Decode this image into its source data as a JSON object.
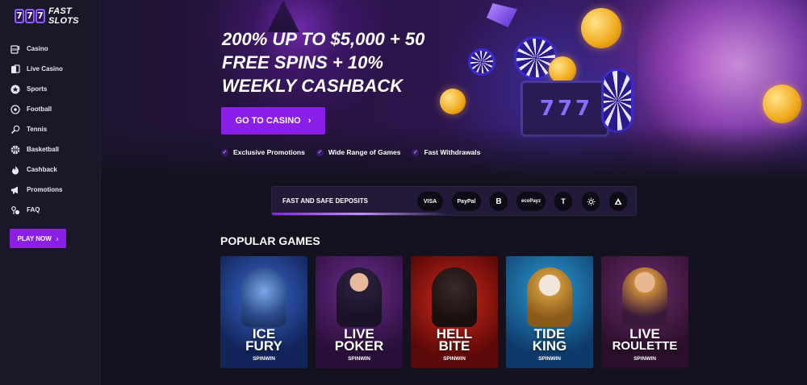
{
  "brand": {
    "logo_digits": "777",
    "name": "FAST SLOTS"
  },
  "sidebar": {
    "items": [
      {
        "label": "Casino",
        "icon": "slot-machine-icon"
      },
      {
        "label": "Live Casino",
        "icon": "cards-icon"
      },
      {
        "label": "Sports",
        "icon": "star-badge-icon"
      },
      {
        "label": "Football",
        "icon": "soccer-ball-icon"
      },
      {
        "label": "Tennis",
        "icon": "tennis-racket-icon"
      },
      {
        "label": "Basketball",
        "icon": "basketball-icon"
      },
      {
        "label": "Cashback",
        "icon": "flame-icon"
      },
      {
        "label": "Promotions",
        "icon": "megaphone-icon"
      },
      {
        "label": "FAQ",
        "icon": "help-icon"
      }
    ],
    "play_now_label": "PLAY NOW"
  },
  "hero": {
    "title_lines": [
      "200% UP TO $5,000 + 50",
      "FREE SPINS + 10%",
      "WEEKLY CASHBACK"
    ],
    "cta_label": "GO TO CASINO",
    "slot_digits": "777",
    "features": [
      "Exclusive Promotions",
      "Wide Range of Games",
      "Fast Withdrawals"
    ]
  },
  "deposits": {
    "label": "FAST AND SAFE DEPOSITS",
    "methods": [
      {
        "label": "VISA",
        "icon": "visa-icon"
      },
      {
        "label": "PayPal",
        "icon": "paypal-icon"
      },
      {
        "label": "B",
        "icon": "bitcoin-icon"
      },
      {
        "label": "ecoPayz",
        "icon": "ecopayz-icon"
      },
      {
        "label": "T",
        "icon": "tether-icon"
      },
      {
        "label": "",
        "icon": "ripple-icon"
      },
      {
        "label": "",
        "icon": "tron-icon"
      }
    ]
  },
  "popular_games": {
    "title": "POPULAR GAMES",
    "games": [
      {
        "name_lines": [
          "ICE",
          "FURY"
        ],
        "provider": "SPINWIN"
      },
      {
        "name_lines": [
          "LIVE",
          "POKER"
        ],
        "provider": "SPINWIN"
      },
      {
        "name_lines": [
          "HELL",
          "BITE"
        ],
        "provider": "SPINWIN"
      },
      {
        "name_lines": [
          "TIDE",
          "KING"
        ],
        "provider": "SPINWIN"
      },
      {
        "name_lines": [
          "LIVE",
          "ROULETTE"
        ],
        "provider": "SPINWIN"
      }
    ]
  },
  "colors": {
    "accent": "#8a1fe8",
    "background": "#14121f",
    "sidebar": "#1a1729"
  }
}
